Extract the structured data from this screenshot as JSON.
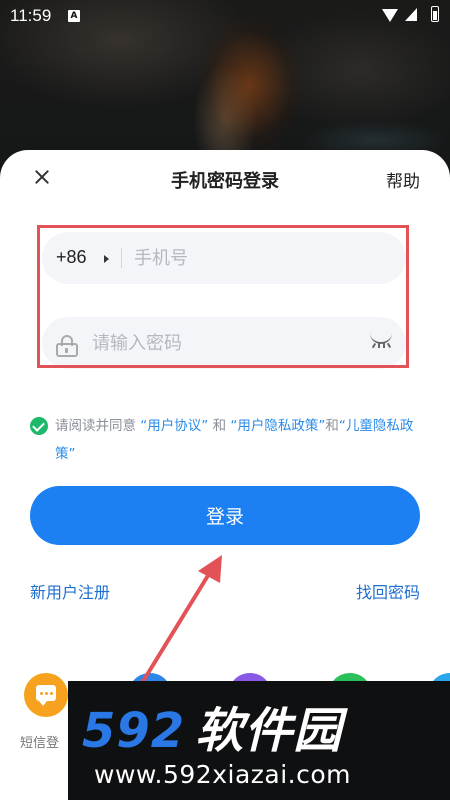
{
  "status_bar": {
    "time": "11:59",
    "notification_icon": "A"
  },
  "header": {
    "title": "手机密码登录",
    "help_label": "帮助"
  },
  "phone": {
    "country_code": "+86",
    "placeholder": "手机号",
    "value": ""
  },
  "password": {
    "placeholder": "请输入密码",
    "value": ""
  },
  "agreement": {
    "checked": true,
    "prefix": "请阅读并同意 ",
    "user_agreement": "“用户协议”",
    "and1": " 和 ",
    "privacy_policy": "“用户隐私政策”",
    "and2": "和",
    "child_privacy": "“儿童隐私政策”"
  },
  "login_button": "登录",
  "links": {
    "register": "新用户注册",
    "forgot_password": "找回密码"
  },
  "alt_login": {
    "sms_label": "短信登"
  },
  "watermark": {
    "number": "592",
    "name": "软件园",
    "url": "www.592xiazai.com"
  },
  "colors": {
    "primary": "#1d80f2",
    "link": "#2b8be8",
    "check": "#1db86a",
    "highlight": "#e25256"
  }
}
